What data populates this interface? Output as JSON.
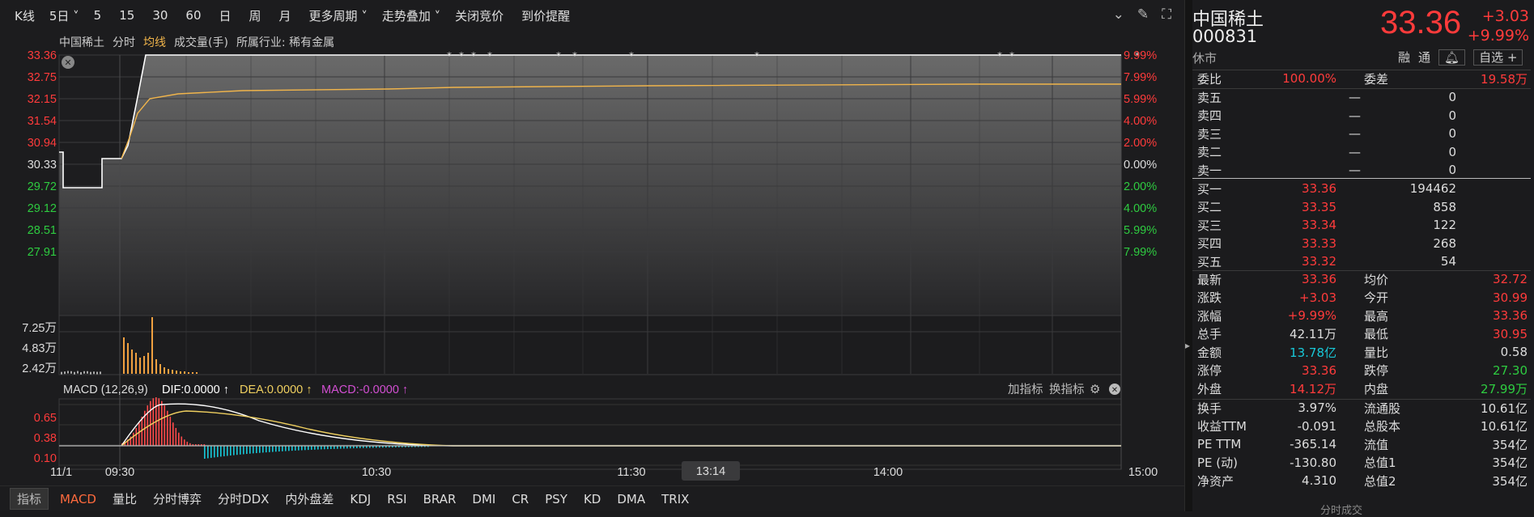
{
  "toolbar": {
    "items": [
      "K线",
      "5日",
      "5",
      "15",
      "30",
      "60",
      "日",
      "周",
      "月",
      "更多周期",
      "走势叠加",
      "关闭竞价",
      "到价提醒"
    ]
  },
  "info": {
    "name": "中国稀土",
    "mode": "分时",
    "avg": "均线",
    "vol": "成交量(手)",
    "industry": "所属行业: 稀有金属"
  },
  "price_axis": {
    "left": [
      "33.36",
      "32.75",
      "32.15",
      "31.54",
      "30.94",
      "30.33",
      "29.72",
      "29.12",
      "28.51",
      "27.91"
    ],
    "right": [
      "9.99%",
      "7.99%",
      "5.99%",
      "4.00%",
      "2.00%",
      "0.00%",
      "2.00%",
      "4.00%",
      "5.99%",
      "7.99%"
    ]
  },
  "volume_axis": [
    "7.25万",
    "4.83万",
    "2.42万"
  ],
  "macd": {
    "title": "MACD (12,26,9)",
    "dif": "DIF:0.0000",
    "dea": "DEA:0.0000",
    "macd": "MACD:-0.0000",
    "axis": [
      "0.65",
      "0.38",
      "0.10"
    ],
    "add": "加指标",
    "swap": "换指标"
  },
  "time_axis": {
    "date": "11/1",
    "labels": [
      "09:30",
      "10:30",
      "11:30",
      "14:00",
      "15:00"
    ],
    "cursor": "13:14"
  },
  "bottombar": {
    "tag": "指标",
    "items": [
      "MACD",
      "量比",
      "分时博弈",
      "分时DDX",
      "内外盘差",
      "KDJ",
      "RSI",
      "BRAR",
      "DMI",
      "CR",
      "PSY",
      "KD",
      "DMA",
      "TRIX"
    ]
  },
  "quote": {
    "name": "中国稀土",
    "code": "000831",
    "status": "休市",
    "price": "33.36",
    "change": "+3.03",
    "pct": "+9.99%",
    "btn_rong": "融",
    "btn_tong": "通",
    "btn_zixuan": "自选 +",
    "weibi_label": "委比",
    "weibi": "100.00%",
    "weicha_label": "委差",
    "weicha": "19.58万",
    "sells": [
      {
        "label": "卖五",
        "price": "—",
        "vol": "0"
      },
      {
        "label": "卖四",
        "price": "—",
        "vol": "0"
      },
      {
        "label": "卖三",
        "price": "—",
        "vol": "0"
      },
      {
        "label": "卖二",
        "price": "—",
        "vol": "0"
      },
      {
        "label": "卖一",
        "price": "—",
        "vol": "0"
      }
    ],
    "buys": [
      {
        "label": "买一",
        "price": "33.36",
        "vol": "194462"
      },
      {
        "label": "买二",
        "price": "33.35",
        "vol": "858"
      },
      {
        "label": "买三",
        "price": "33.34",
        "vol": "122"
      },
      {
        "label": "买四",
        "price": "33.33",
        "vol": "268"
      },
      {
        "label": "买五",
        "price": "33.32",
        "vol": "54"
      }
    ],
    "stats": [
      {
        "l1": "最新",
        "v1": "33.36",
        "c1": "red",
        "l2": "均价",
        "v2": "32.72",
        "c2": "red"
      },
      {
        "l1": "涨跌",
        "v1": "+3.03",
        "c1": "red",
        "l2": "今开",
        "v2": "30.99",
        "c2": "red"
      },
      {
        "l1": "涨幅",
        "v1": "+9.99%",
        "c1": "red",
        "l2": "最高",
        "v2": "33.36",
        "c2": "red"
      },
      {
        "l1": "总手",
        "v1": "42.11万",
        "c1": "white",
        "l2": "最低",
        "v2": "30.95",
        "c2": "red"
      },
      {
        "l1": "金额",
        "v1": "13.78亿",
        "c1": "cyan",
        "l2": "量比",
        "v2": "0.58",
        "c2": "white"
      },
      {
        "l1": "涨停",
        "v1": "33.36",
        "c1": "red",
        "l2": "跌停",
        "v2": "27.30",
        "c2": "green"
      },
      {
        "l1": "外盘",
        "v1": "14.12万",
        "c1": "red",
        "l2": "内盘",
        "v2": "27.99万",
        "c2": "green"
      }
    ],
    "fund": [
      {
        "l1": "换手",
        "v1": "3.97%",
        "l2": "流通股",
        "v2": "10.61亿"
      },
      {
        "l1": "收益TTM",
        "v1": "-0.091",
        "l2": "总股本",
        "v2": "10.61亿"
      },
      {
        "l1": "PE TTM",
        "v1": "-365.14",
        "l2": "流值",
        "v2": "354亿"
      },
      {
        "l1": "PE (动)",
        "v1": "-130.80",
        "l2": "总值1",
        "v2": "354亿"
      },
      {
        "l1": "净资产",
        "v1": "4.310",
        "l2": "总值2",
        "v2": "354亿"
      }
    ],
    "bottom": "分时成交"
  },
  "colors": {
    "up": "#ff3b3b",
    "down": "#2ecc40",
    "avg": "#f0b44b",
    "price": "#ffffff"
  }
}
